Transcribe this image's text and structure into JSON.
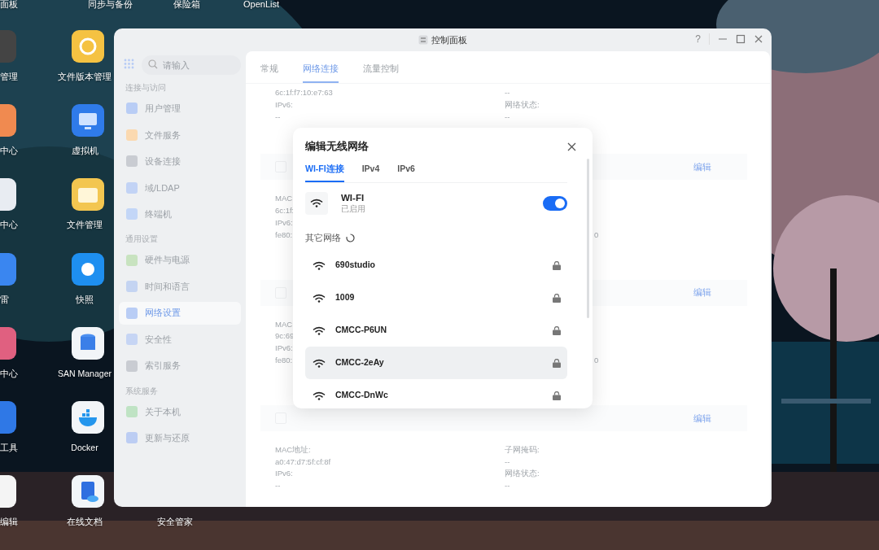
{
  "desktop": {
    "top_labels": [
      "面板",
      "同步与备份",
      "保险箱",
      "OpenList"
    ],
    "column_1": [
      "管理",
      "中心",
      "中心",
      "雷",
      "中心",
      "工具",
      "编辑"
    ],
    "column_2": [
      "文件版本管理",
      "虚拟机",
      "文件管理",
      "快照",
      "SAN Manager",
      "Docker",
      "在线文档"
    ],
    "column_3": [
      "安全管家"
    ]
  },
  "window": {
    "title": "控制面板",
    "help": "?"
  },
  "sidebar": {
    "search": {
      "placeholder": "请输入"
    },
    "groups": [
      {
        "title": "连接与访问",
        "items": [
          {
            "label": "用户管理",
            "selected": false
          },
          {
            "label": "文件服务",
            "selected": false
          },
          {
            "label": "设备连接",
            "selected": false
          },
          {
            "label": "域/LDAP",
            "selected": false
          },
          {
            "label": "终端机",
            "selected": false
          }
        ]
      },
      {
        "title": "通用设置",
        "items": [
          {
            "label": "硬件与电源",
            "selected": false
          },
          {
            "label": "时间和语言",
            "selected": false
          },
          {
            "label": "网络设置",
            "selected": true
          },
          {
            "label": "安全性",
            "selected": false
          },
          {
            "label": "索引服务",
            "selected": false
          }
        ]
      },
      {
        "title": "系统服务",
        "items": [
          {
            "label": "关于本机",
            "selected": false
          },
          {
            "label": "更新与还原",
            "selected": false
          }
        ]
      }
    ]
  },
  "tabs": [
    {
      "label": "常规",
      "selected": false
    },
    {
      "label": "网络连接",
      "selected": true
    },
    {
      "label": "流量控制",
      "selected": false
    }
  ],
  "sections": [
    {
      "left": [
        "6c:1f:f7:10:e7:63",
        "IPv6:",
        "--"
      ],
      "right": [
        "--",
        "网络状态:",
        "--"
      ]
    },
    {
      "edit": "编辑",
      "left": [
        "MAC",
        "6c:1f:",
        "IPv6:",
        "fe80::"
      ],
      "tail": "0"
    },
    {
      "edit": "编辑",
      "left": [
        "MAC",
        "9c:69",
        "IPv6:",
        "fe80::"
      ],
      "tail": "0"
    },
    {
      "edit": "编辑",
      "left": [
        "MAC地址:",
        "a0:47:d7:5f:cf:8f",
        "IPv6:",
        "--"
      ],
      "right": [
        "子网掩码:",
        "--",
        "网络状态:",
        "--"
      ]
    }
  ],
  "dialog": {
    "title": "编辑无线网络",
    "tabs": [
      {
        "label": "WI-FI连接",
        "selected": true
      },
      {
        "label": "IPv4",
        "selected": false
      },
      {
        "label": "IPv6",
        "selected": false
      }
    ],
    "wifi": {
      "name": "WI-FI",
      "status": "已启用",
      "on": true
    },
    "other_title": "其它网络",
    "networks": [
      {
        "name": "690studio",
        "highlighted": false
      },
      {
        "name": "1009",
        "highlighted": false
      },
      {
        "name": "CMCC-P6UN",
        "highlighted": false
      },
      {
        "name": "CMCC-2eAy",
        "highlighted": true
      },
      {
        "name": "CMCC-DnWc",
        "highlighted": false
      }
    ]
  }
}
